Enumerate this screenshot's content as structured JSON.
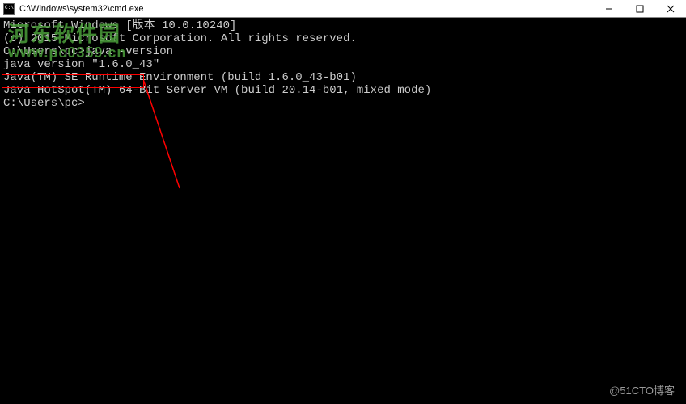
{
  "titlebar": {
    "title": "C:\\Windows\\system32\\cmd.exe"
  },
  "terminal": {
    "line1": "Microsoft Windows [版本 10.0.10240]",
    "line2": "(c) 2015 Microsoft Corporation. All rights reserved.",
    "line3": "",
    "line4": "C:\\Users\\pc>java -version",
    "line5": "java version \"1.6.0_43\"",
    "line6": "Java(TM) SE Runtime Environment (build 1.6.0_43-b01)",
    "line7": "Java HotSpot(TM) 64-Bit Server VM (build 20.14-b01, mixed mode)",
    "line8": "",
    "line9": "C:\\Users\\pc>"
  },
  "watermark": {
    "cn_title": "河东软件园",
    "cn_url": "www.pc0359.cn",
    "footer": "@51CTO博客"
  },
  "annotation": {
    "highlight_color": "#ff0000"
  }
}
